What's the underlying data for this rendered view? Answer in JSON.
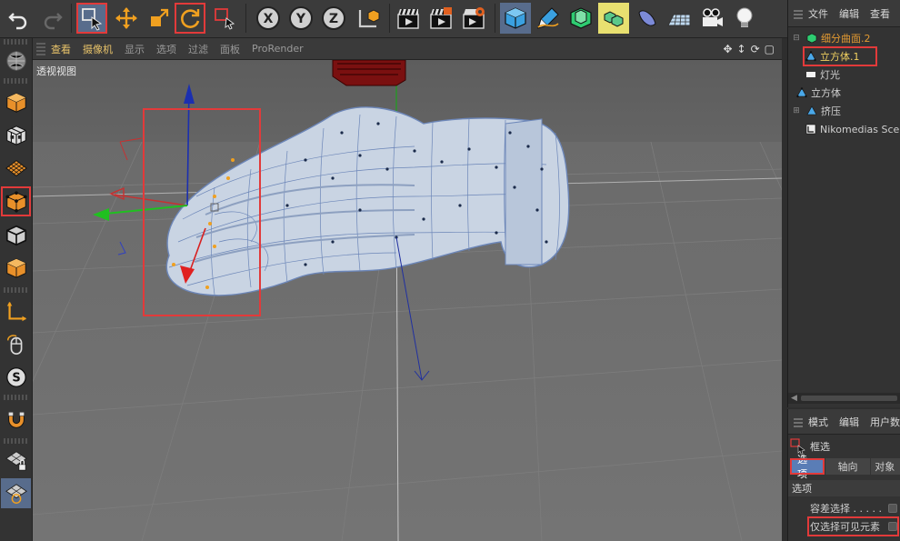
{
  "toolbar": {
    "buttons": [
      {
        "id": "undo",
        "icon": "undo-icon"
      },
      {
        "id": "redo",
        "icon": "redo-icon"
      },
      {
        "id": "live-select",
        "icon": "live-select-icon"
      },
      {
        "id": "move",
        "icon": "move-icon"
      },
      {
        "id": "scale",
        "icon": "scale-icon"
      },
      {
        "id": "rotate",
        "icon": "rotate-icon"
      },
      {
        "id": "recent-tools",
        "icon": "recent-tools-icon"
      },
      {
        "id": "x-axis",
        "icon": "x-axis-icon",
        "label": "X"
      },
      {
        "id": "y-axis",
        "icon": "y-axis-icon",
        "label": "Y"
      },
      {
        "id": "z-axis",
        "icon": "z-axis-icon",
        "label": "Z"
      },
      {
        "id": "coordinate-system",
        "icon": "coordinate-system-icon"
      },
      {
        "id": "render-view",
        "icon": "clapperboard-icon"
      },
      {
        "id": "render-to-picture-viewer",
        "icon": "clapperboard-play-icon"
      },
      {
        "id": "render-settings",
        "icon": "clapperboard-gear-icon"
      },
      {
        "id": "cube",
        "icon": "cube-icon"
      },
      {
        "id": "pen",
        "icon": "pen-icon"
      },
      {
        "id": "subdivision",
        "icon": "subdivision-icon"
      },
      {
        "id": "array",
        "icon": "array-icon"
      },
      {
        "id": "deformer",
        "icon": "deformer-icon"
      },
      {
        "id": "floor",
        "icon": "floor-icon"
      },
      {
        "id": "camera",
        "icon": "camera-icon"
      },
      {
        "id": "light",
        "icon": "light-bulb-icon"
      }
    ]
  },
  "leftbar": {
    "buttons": [
      {
        "id": "make-editable",
        "icon": "make-editable-icon"
      },
      {
        "id": "model-mode",
        "icon": "model-mode-icon"
      },
      {
        "id": "texture-mode",
        "icon": "texture-mode-icon"
      },
      {
        "id": "workplane-mode",
        "icon": "workplane-mode-icon"
      },
      {
        "id": "points-mode",
        "icon": "points-mode-icon"
      },
      {
        "id": "edges-mode",
        "icon": "edges-mode-icon"
      },
      {
        "id": "polygons-mode",
        "icon": "polygons-mode-icon"
      },
      {
        "id": "axis-mode",
        "icon": "axis-mode-icon"
      },
      {
        "id": "tweak-mode",
        "icon": "mouse-tweak-icon"
      },
      {
        "id": "solo",
        "icon": "solo-icon"
      },
      {
        "id": "snap",
        "icon": "magnet-icon"
      },
      {
        "id": "lock-workplane",
        "icon": "lock-grid-icon"
      },
      {
        "id": "planar-workplane",
        "icon": "planar-grid-icon"
      }
    ]
  },
  "viewport": {
    "menu": [
      "查看",
      "摄像机",
      "显示",
      "选项",
      "过滤",
      "面板",
      "ProRender"
    ],
    "title": "透视视图"
  },
  "object_manager": {
    "tabs": [
      "文件",
      "编辑",
      "查看"
    ],
    "items": [
      {
        "label": "细分曲面.2",
        "icon": "subdivision-surface-icon",
        "color": "#e39a32"
      },
      {
        "label": "立方体.1",
        "icon": "polygon-object-icon",
        "color": "#f0d060"
      },
      {
        "label": "灯光",
        "icon": "light-object-icon",
        "color": "#cfcfcf"
      },
      {
        "label": "立方体",
        "icon": "polygon-object-icon",
        "color": "#cfcfcf"
      },
      {
        "label": "挤压",
        "icon": "extrude-icon",
        "color": "#cfcfcf"
      },
      {
        "label": "Nikomedias Scene",
        "icon": "layer-icon",
        "color": "#cfcfcf"
      }
    ]
  },
  "attribute_manager": {
    "tabs": [
      "模式",
      "编辑",
      "用户数据"
    ],
    "tool_name": "框选",
    "subtabs": [
      "选项",
      "轴向",
      "对象"
    ],
    "section": "选项",
    "options": [
      {
        "label": "容差选择 . . . . .",
        "checked": false
      },
      {
        "label": "仅选择可见元素",
        "checked": false
      }
    ]
  },
  "colors": {
    "highlight": "#e23a3a",
    "active_tab": "#5a7db6",
    "menu_active": "#e8c36a"
  }
}
